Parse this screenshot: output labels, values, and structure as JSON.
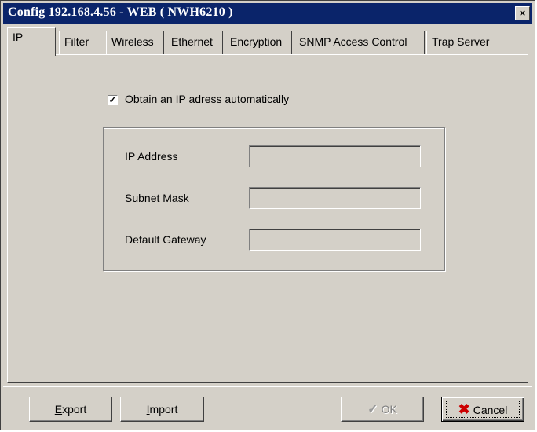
{
  "window": {
    "title": "Config 192.168.4.56 - WEB ( NWH6210 )",
    "close_label": "×"
  },
  "tabs": [
    {
      "label": "IP",
      "active": true
    },
    {
      "label": "Filter"
    },
    {
      "label": "Wireless"
    },
    {
      "label": "Ethernet"
    },
    {
      "label": "Encryption"
    },
    {
      "label": "SNMP Access Control"
    },
    {
      "label": "Trap Server"
    }
  ],
  "ip": {
    "obtain_auto": {
      "label": "Obtain an IP adress automatically",
      "checked": true,
      "mark": "✓"
    },
    "fields": [
      {
        "label": "IP Address",
        "value": ""
      },
      {
        "label": "Subnet Mask",
        "value": ""
      },
      {
        "label": "Default Gateway",
        "value": ""
      }
    ]
  },
  "buttons": {
    "export_accel": "E",
    "export_rest": "xport",
    "import_accel": "I",
    "import_rest": "mport",
    "ok": "OK",
    "ok_icon": "check-icon",
    "cancel": "Cancel",
    "cancel_icon": "x-icon"
  }
}
